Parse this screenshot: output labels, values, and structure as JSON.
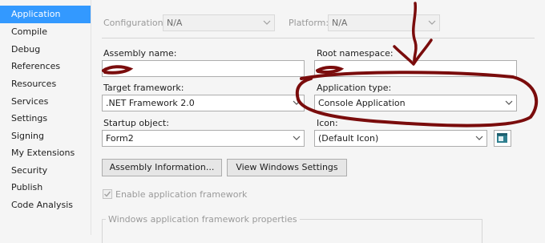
{
  "sidebar": {
    "items": [
      {
        "label": "Application"
      },
      {
        "label": "Compile"
      },
      {
        "label": "Debug"
      },
      {
        "label": "References"
      },
      {
        "label": "Resources"
      },
      {
        "label": "Services"
      },
      {
        "label": "Settings"
      },
      {
        "label": "Signing"
      },
      {
        "label": "My Extensions"
      },
      {
        "label": "Security"
      },
      {
        "label": "Publish"
      },
      {
        "label": "Code Analysis"
      }
    ],
    "active": "Application"
  },
  "toolbar": {
    "configuration_label": "Configuration:",
    "configuration_value": "N/A",
    "platform_label": "Platform:",
    "platform_value": "N/A"
  },
  "form": {
    "assembly_name_label": "Assembly name:",
    "assembly_name_value": "",
    "root_namespace_label": "Root namespace:",
    "root_namespace_value": "",
    "target_framework_label": "Target framework:",
    "target_framework_value": ".NET Framework 2.0",
    "application_type_label": "Application type:",
    "application_type_value": "Console Application",
    "startup_object_label": "Startup object:",
    "startup_object_value": "Form2",
    "icon_label": "Icon:",
    "icon_value": "(Default Icon)",
    "assembly_information_button": "Assembly Information...",
    "view_windows_settings_button": "View Windows Settings",
    "enable_framework_label": "Enable application framework",
    "enable_framework_checked": true,
    "framework_properties_group": "Windows application framework properties"
  },
  "annotation_color": "#7a0c0c"
}
